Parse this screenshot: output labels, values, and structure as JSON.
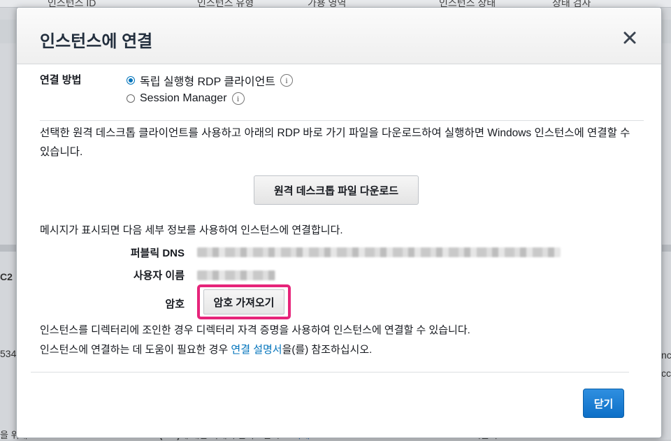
{
  "background": {
    "columns": [
      "인스턴스 ID",
      "인스턴스 유형",
      "가용 영역",
      "인스턴스 상태",
      "상태 검사"
    ],
    "left_fragments": [
      "C2",
      "534"
    ],
    "right_fragments": [
      "nc",
      "cc"
    ],
    "footer_prefix": "을 위해 ",
    "footer_bold": "AWS Command Line Interface(CLI)",
    "footer_text": "에 대한 자세히 알아보십시오. ",
    "footer_link": "자세",
    "footer_right": "퍼블릭 IP"
  },
  "modal": {
    "title": "인스턴스에 연결",
    "method_label": "연결 방법",
    "options": [
      {
        "label": "독립 실행형 RDP 클라이언트",
        "checked": true
      },
      {
        "label": "Session Manager",
        "checked": false
      }
    ],
    "info_glyph": "i",
    "description": "선택한 원격 데스크톱 클라이언트를 사용하고 아래의 RDP 바로 가기 파일을 다운로드하여 실행하면 Windows 인스턴스에 연결할 수 있습니다.",
    "download_button": "원격 데스크톱 파일 다운로드",
    "details_message": "메시지가 표시되면 다음 세부 정보를 사용하여 인스턴스에 연결합니다.",
    "public_dns_label": "퍼블릭 DNS",
    "username_label": "사용자 이름",
    "password_label": "암호",
    "get_password_button": "암호 가져오기",
    "note_domain": "인스턴스를 디렉터리에 조인한 경우 디렉터리 자격 증명을 사용하여 인스턴스에 연결할 수 있습니다.",
    "note_help_prefix": "인스턴스에 연결하는 데 도움이 필요한 경우 ",
    "note_help_link": "연결 설명서",
    "note_help_suffix": "을(를) 참조하십시오.",
    "close_button": "닫기"
  },
  "colors": {
    "highlight": "#e6247a",
    "primary": "#0d6fc7",
    "link": "#0073bb"
  }
}
